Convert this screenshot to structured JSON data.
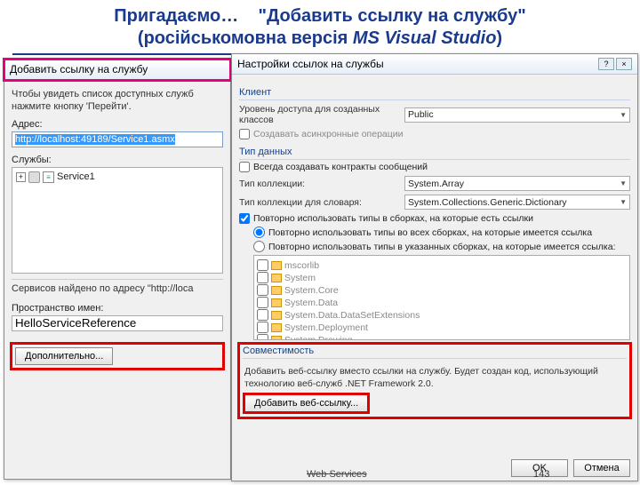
{
  "slide": {
    "title_prefix": "Пригадаємо…",
    "title_quote": "\"Добавить ссылку на службу\"",
    "title_sub": "(російськомовна версія ",
    "title_product": "MS Visual Studio",
    "title_sub_end": ")",
    "footer_center": "Web Services",
    "page_number": "143"
  },
  "left_dialog": {
    "title": "Добавить ссылку на службу",
    "hint": "Чтобы увидеть список доступных служб нажмите кнопку 'Перейти'.",
    "address_label": "Адрес:",
    "address_value": "http://localhost:49189/Service1.asmx",
    "services_label": "Службы:",
    "service_name": "Service1",
    "found_label": "Сервисов найдено по адресу \"http://loca",
    "namespace_label": "Пространство имен:",
    "namespace_value": "HelloServiceReference",
    "btn_more": "Дополнительно..."
  },
  "right_dialog": {
    "title": "Настройки ссылок на службы",
    "section_client": "Клиент",
    "access_label": "Уровень доступа для созданных классов",
    "access_value": "Public",
    "async_label": "Создавать асинхронные операции",
    "section_datatype": "Тип данных",
    "always_contracts": "Всегда создавать контракты сообщений",
    "coll_label": "Тип коллекции:",
    "coll_value": "System.Array",
    "dict_label": "Тип коллекции для словаря:",
    "dict_value": "System.Collections.Generic.Dictionary",
    "reuse_main": "Повторно использовать типы в сборках, на которые есть ссылки",
    "reuse_all": "Повторно использовать типы во всех сборках, на которые имеется ссылка",
    "reuse_sel": "Повторно использовать типы в указанных сборках, на которые имеется ссылка:",
    "assemblies": [
      "mscorlib",
      "System",
      "System.Core",
      "System.Data",
      "System.Data.DataSetExtensions",
      "System.Deployment",
      "System.Drawing"
    ],
    "section_compat": "Совместимость",
    "compat_text": "Добавить веб-ссылку вместо ссылки на службу. Будет создан код, использующий технологию веб-служб .NET Framework 2.0.",
    "btn_addweb": "Добавить веб-ссылку...",
    "btn_ok": "OK",
    "btn_cancel": "Отмена"
  }
}
